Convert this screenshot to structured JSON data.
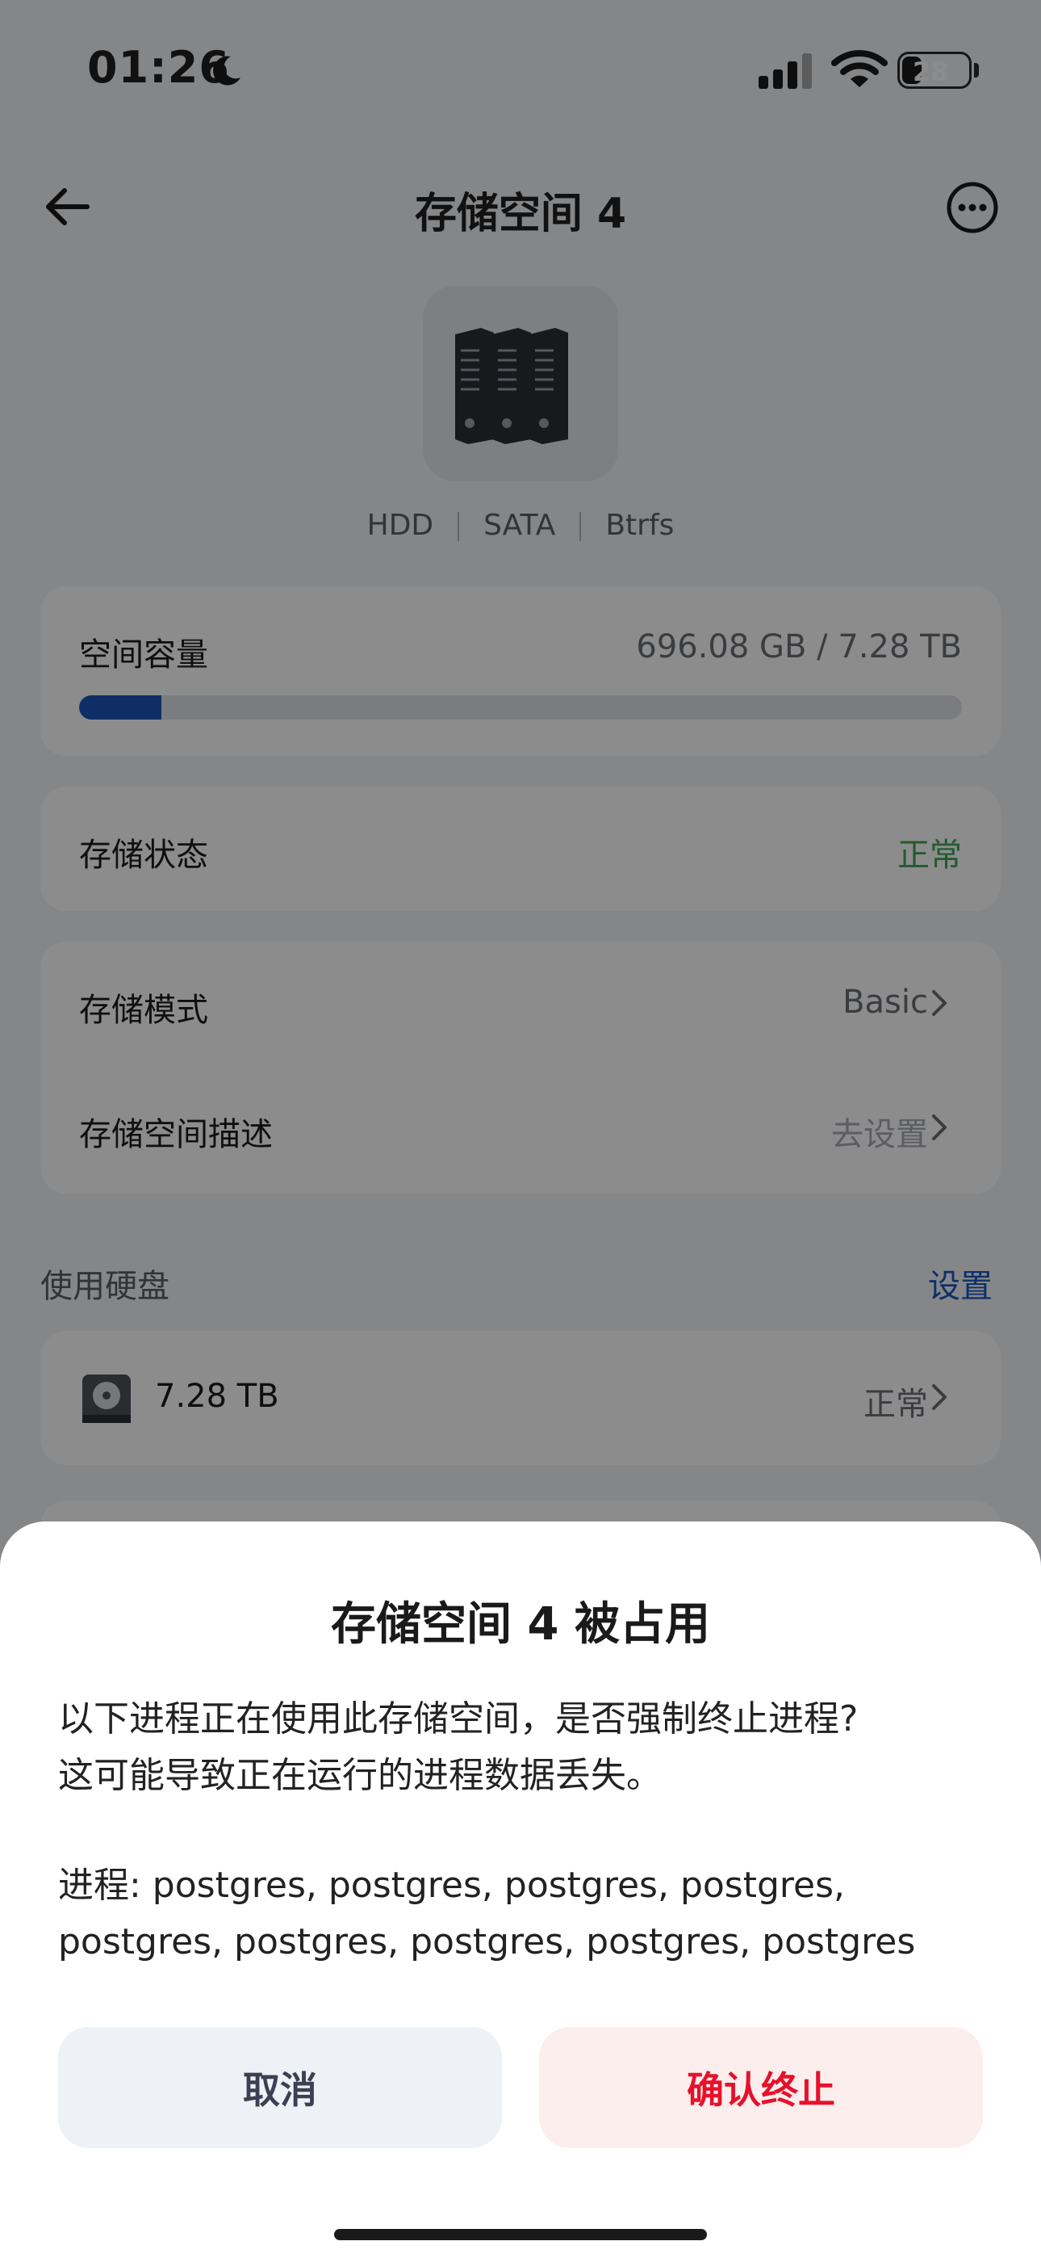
{
  "status_bar": {
    "time": "01:26",
    "battery": "28"
  },
  "nav": {
    "title": "存储空间 4"
  },
  "device": {
    "tags": [
      "HDD",
      "SATA",
      "Btrfs"
    ]
  },
  "capacity": {
    "label": "空间容量",
    "value": "696.08 GB / 7.28 TB",
    "used_fraction": 0.0934
  },
  "status": {
    "label": "存储状态",
    "value": "正常",
    "value_color": "#3ea65a"
  },
  "mode": {
    "label": "存储模式",
    "value": "Basic"
  },
  "description": {
    "label": "存储空间描述",
    "value": "去设置"
  },
  "disks": {
    "header": "使用硬盘",
    "action": "设置",
    "items": [
      {
        "size": "7.28 TB",
        "status": "正常"
      }
    ]
  },
  "dialog": {
    "title": "存储空间 4 被占用",
    "message_line1": "以下进程正在使用此存储空间，是否强制终止进程?",
    "message_line2": "这可能导致正在运行的进程数据丢失。",
    "process_line1": "进程: postgres, postgres, postgres, postgres,",
    "process_line2": "postgres, postgres, postgres, postgres, postgres",
    "cancel_label": "取消",
    "confirm_label": "确认终止"
  },
  "colors": {
    "accent": "#1b56c0",
    "danger": "#e6112b",
    "success": "#3ea65a"
  }
}
